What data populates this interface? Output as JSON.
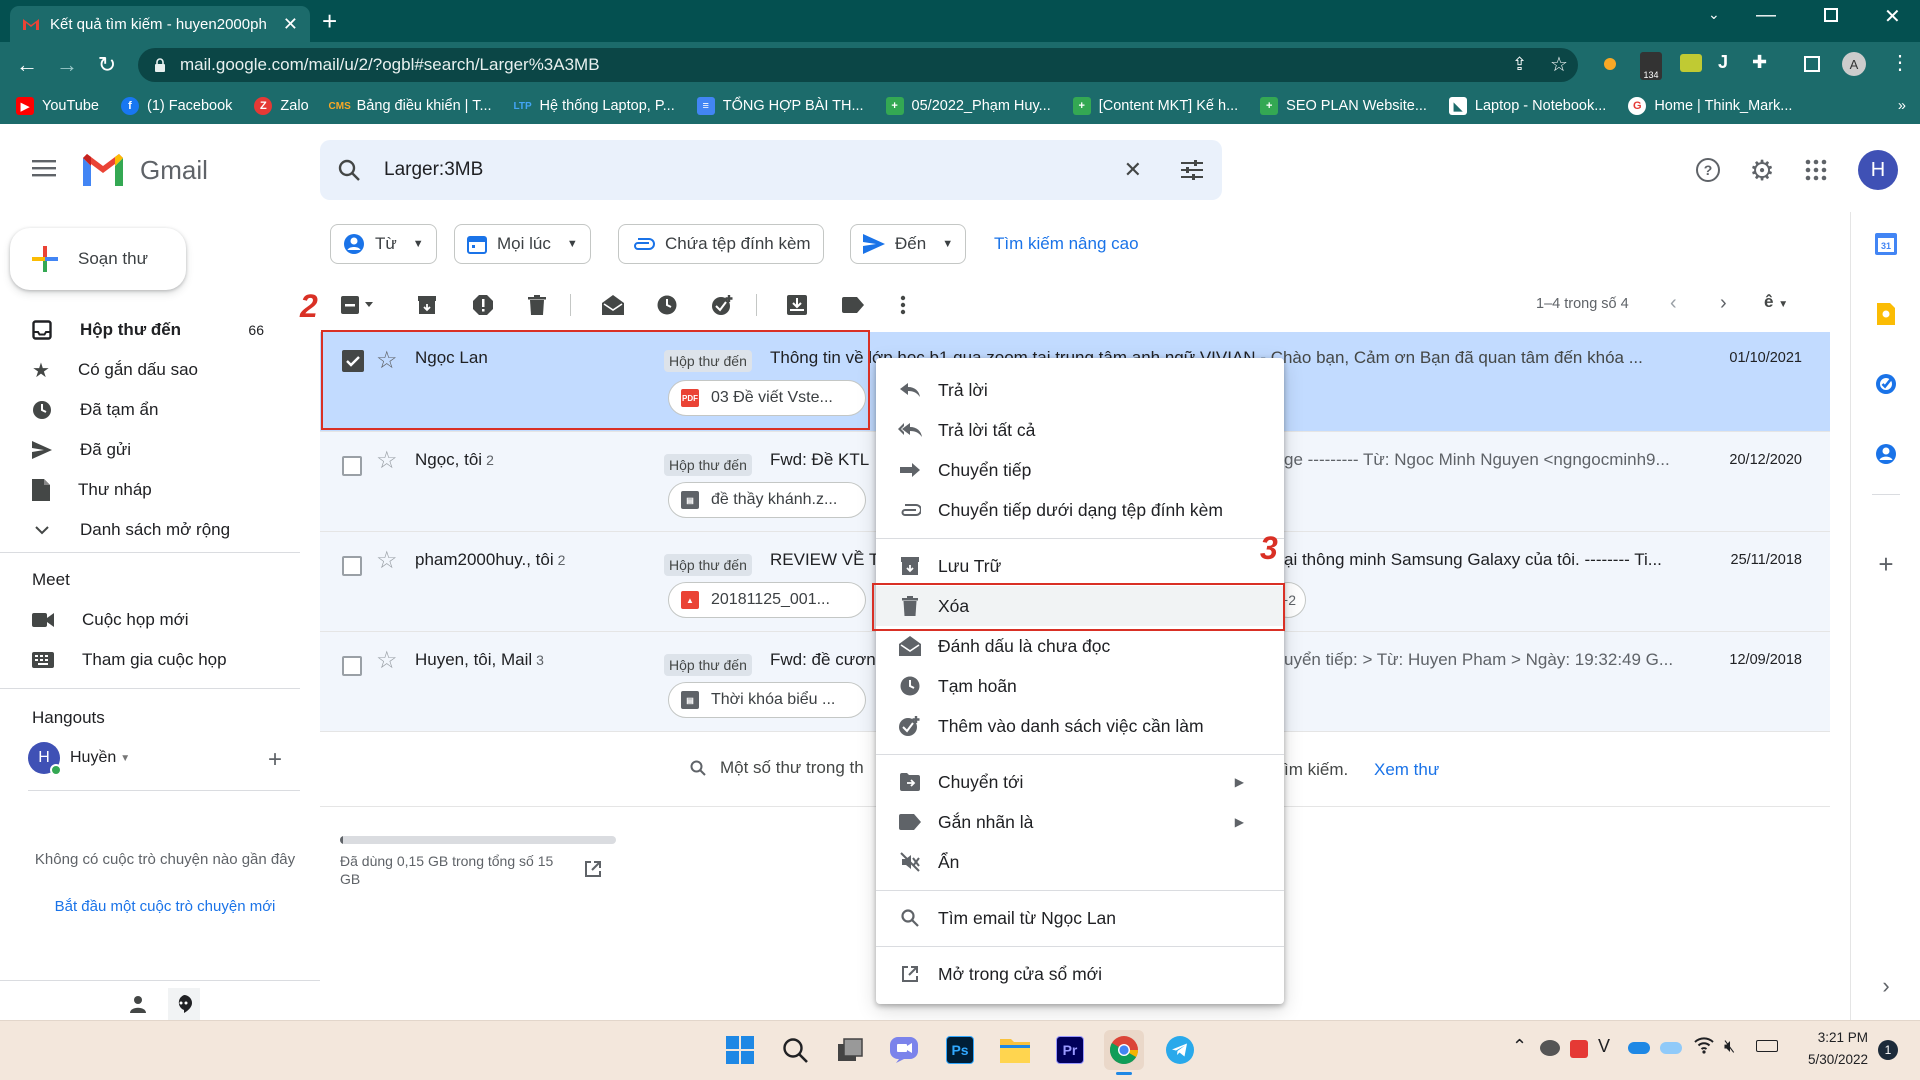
{
  "browser": {
    "tab_title": "Kết quả tìm kiếm - huyen2000ph",
    "url": "mail.google.com/mail/u/2/?ogbl#search/Larger%3A3MB",
    "ext_badge": "134",
    "profile_initial": "A",
    "bookmarks": [
      {
        "label": "YouTube",
        "icon": "youtube-icon",
        "color": "#ff0000"
      },
      {
        "label": "(1) Facebook",
        "icon": "facebook-icon",
        "color": "#1877f2"
      },
      {
        "label": "Zalo",
        "icon": "zalo-icon",
        "color": "#e53935"
      },
      {
        "label": "Bảng điều khiển | T...",
        "icon": "cms-icon",
        "color": "#f9a825"
      },
      {
        "label": "Hệ thống Laptop, P...",
        "icon": "ltp-icon",
        "color": "#42a5f5"
      },
      {
        "label": "TỔNG HỢP BÀI TH...",
        "icon": "docs-icon",
        "color": "#4285f4"
      },
      {
        "label": "05/2022_Phạm Huy...",
        "icon": "sheets-plus-icon",
        "color": "#34a853"
      },
      {
        "label": "[Content MKT] Kế h...",
        "icon": "sheets-plus-icon",
        "color": "#34a853"
      },
      {
        "label": "SEO PLAN Website...",
        "icon": "sheets-plus-icon",
        "color": "#34a853"
      },
      {
        "label": "Laptop - Notebook...",
        "icon": "laptop-site-icon",
        "color": "#ffffff"
      },
      {
        "label": "Home | Think_Mark...",
        "icon": "think-site-icon",
        "color": "#e53935"
      }
    ]
  },
  "gmail": {
    "brand": "Gmail",
    "search_query": "Larger:3MB",
    "avatar_initial": "H",
    "compose_label": "Soạn thư",
    "nav": [
      {
        "label": "Hộp thư đến",
        "count": "66",
        "icon": "inbox-icon"
      },
      {
        "label": "Có gắn dấu sao",
        "count": "",
        "icon": "star-icon"
      },
      {
        "label": "Đã tạm ẩn",
        "count": "",
        "icon": "clock-icon"
      },
      {
        "label": "Đã gửi",
        "count": "",
        "icon": "send-icon"
      },
      {
        "label": "Thư nháp",
        "count": "",
        "icon": "draft-icon"
      },
      {
        "label": "Danh sách mở rộng",
        "count": "",
        "icon": "chevron-down-icon"
      }
    ],
    "meet": {
      "title": "Meet",
      "items": [
        {
          "label": "Cuộc họp mới",
          "icon": "video-icon"
        },
        {
          "label": "Tham gia cuộc họp",
          "icon": "keyboard-icon"
        }
      ]
    },
    "hangouts": {
      "title": "Hangouts",
      "user": "Huyền",
      "empty_text": "Không có cuộc trò chuyện nào gần đây",
      "start_link": "Bắt đầu một cuộc trò chuyện mới"
    },
    "filters": {
      "from": "Từ",
      "time": "Mọi lúc",
      "attachment": "Chứa tệp đính kèm",
      "to": "Đến",
      "advanced": "Tìm kiếm nâng cao"
    },
    "pagination": "1–4 trong số 4",
    "emails": [
      {
        "sender": "Ngọc Lan",
        "count": "",
        "label": "Hộp thư đến",
        "subject": "Thông tin về lớp học b1 qua zoom tại trung tâm anh ngữ VIVIAN",
        "snippet": " - Chào bạn, Cảm ơn Bạn đã quan tâm đến khóa ...",
        "date": "01/10/2021",
        "attachment": "03 Đề viết Vste...",
        "attachment_type": "pdf",
        "selected": true
      },
      {
        "sender": "Ngọc, tôi",
        "count": "2",
        "label": "Hộp thư đến",
        "subject": "Fwd: Đề KTL",
        "snippet": "ge --------- Từ: Ngoc Minh Nguyen <ngngocminh9...",
        "date": "20/12/2020",
        "attachment": "đề thầy khánh.z...",
        "attachment_type": "archive",
        "selected": false
      },
      {
        "sender": "pham2000huy., tôi",
        "count": "2",
        "label": "Hộp thư đến",
        "subject": "REVIEW VỀ T",
        "snippet": "ại thông minh Samsung Galaxy của tôi. -------- Ti...",
        "date": "25/11/2018",
        "attachment": "20181125_001...",
        "attachment_type": "image",
        "extra": "+2",
        "selected": false
      },
      {
        "sender": "Huyen, tôi, Mail",
        "count": "3",
        "label": "Hộp thư đến",
        "subject": "Fwd: đề cươn",
        "snippet": "uyển tiếp: > Từ: Huyen Pham > Ngày: 19:32:49 G...",
        "date": "12/09/2018",
        "attachment": "Thời khóa biểu ...",
        "attachment_type": "archive",
        "selected": false
      }
    ],
    "notice": {
      "text_left": "Một số thư trong th",
      "text_right": "ìm kiếm.",
      "link": "Xem thư"
    },
    "storage": {
      "text": "Đã dùng 0,15 GB trong tổng số 15 GB",
      "used_fraction": 0.01
    }
  },
  "context_menu": {
    "items": [
      {
        "label": "Trả lời",
        "icon": "reply-icon"
      },
      {
        "label": "Trả lời tất cả",
        "icon": "reply-all-icon"
      },
      {
        "label": "Chuyển tiếp",
        "icon": "forward-icon"
      },
      {
        "label": "Chuyển tiếp dưới dạng tệp đính kèm",
        "icon": "attachment-icon"
      },
      {
        "label": "Lưu Trữ",
        "icon": "archive-icon"
      },
      {
        "label": "Xóa",
        "icon": "trash-icon"
      },
      {
        "label": "Đánh dấu là chưa đọc",
        "icon": "mark-unread-icon"
      },
      {
        "label": "Tạm hoãn",
        "icon": "clock-icon"
      },
      {
        "label": "Thêm vào danh sách việc cần làm",
        "icon": "add-task-icon"
      },
      {
        "label": "Chuyển tới",
        "icon": "move-to-icon"
      },
      {
        "label": "Gắn nhãn là",
        "icon": "label-icon"
      },
      {
        "label": "Ẩn",
        "icon": "mute-icon"
      },
      {
        "label": "Tìm email từ Ngọc Lan",
        "icon": "search-icon"
      },
      {
        "label": "Mở trong cửa sổ mới",
        "icon": "open-new-icon"
      }
    ]
  },
  "annotations": {
    "step2": "2",
    "step3": "3"
  },
  "taskbar": {
    "time": "3:21 PM",
    "date": "5/30/2022",
    "notif_count": "1"
  }
}
